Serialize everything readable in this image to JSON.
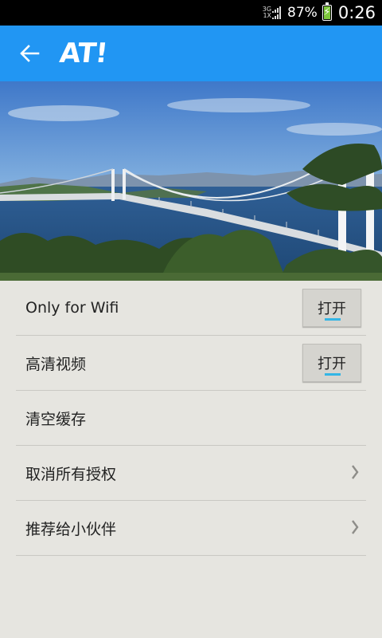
{
  "status_bar": {
    "network_top": "3G",
    "network_bottom": "1X",
    "battery_percent": "87%",
    "battery_level": 0.87,
    "time": "0:26"
  },
  "app_bar": {
    "logo_text": "AT!",
    "background_color": "#2196f3"
  },
  "settings": {
    "items": [
      {
        "label": "Only for Wifi",
        "control": "toggle",
        "toggle_label": "打开"
      },
      {
        "label": "高清视频",
        "control": "toggle",
        "toggle_label": "打开"
      },
      {
        "label": "清空缓存",
        "control": "none"
      },
      {
        "label": "取消所有授权",
        "control": "chevron"
      },
      {
        "label": "推荐给小伙伴",
        "control": "chevron"
      }
    ]
  },
  "colors": {
    "background": "#e6e5e0",
    "toggle_indicator": "#33b5e5",
    "divider": "#c9c8c3"
  }
}
